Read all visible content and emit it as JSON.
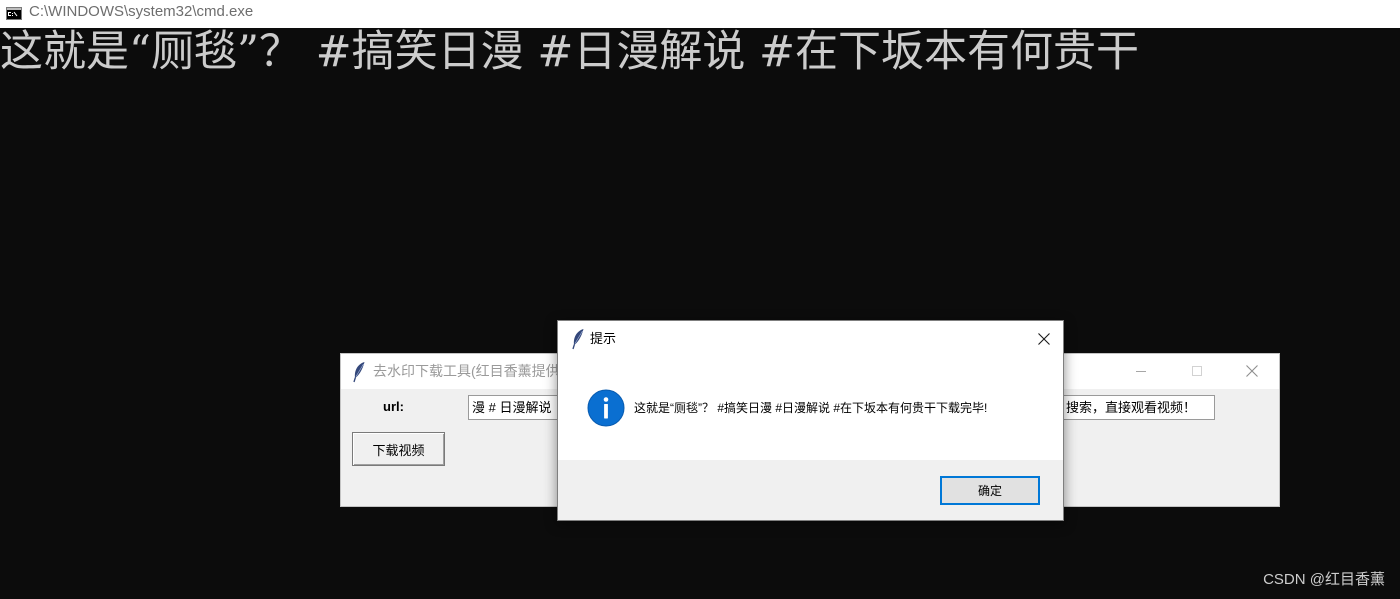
{
  "cmd_window": {
    "title": "C:\\WINDOWS\\system32\\cmd.exe",
    "icon": "cmd-icon",
    "console_line": "这就是“厕毯”？ #搞笑日漫 #日漫解说 #在下坂本有何贵干",
    "colors": {
      "background": "#0c0c0c",
      "text": "#cccccc"
    }
  },
  "tool_window": {
    "title": "去水印下载工具(红目香薰提供",
    "icon": "feather-icon",
    "controls": [
      "minimize-icon",
      "maximize-icon",
      "close-icon"
    ],
    "url_label": "url:",
    "url_input": {
      "value_visible_start": "漫 # 日漫解说",
      "value_visible_end": "搜索，直接观看视频！"
    },
    "download_button_label": "下载视频"
  },
  "message_dialog": {
    "title": "提示",
    "icon": "feather-icon",
    "status_icon": "info-icon",
    "message": "这就是“厕毯”？ #搞笑日漫 #日漫解说 #在下坂本有何贵干下载完毕!",
    "ok_button_label": "确定",
    "accent_color": "#0078d7",
    "info_icon_color": "#0a6fd1"
  },
  "watermark": "CSDN @红目香薰"
}
